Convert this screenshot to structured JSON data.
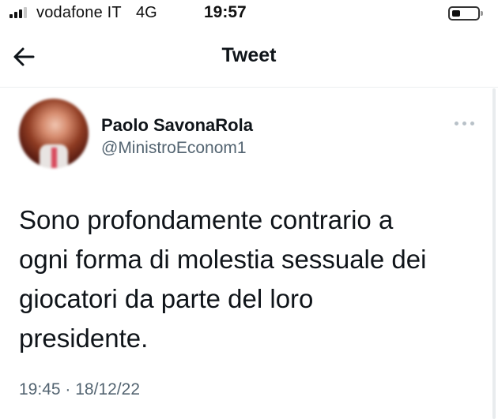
{
  "status_bar": {
    "carrier": "vodafone IT",
    "network": "4G",
    "time": "19:57"
  },
  "header": {
    "title": "Tweet"
  },
  "tweet": {
    "author_name": "Paolo SavonaRola",
    "author_handle": "@MinistroEconom1",
    "text_lines": [
      "Sono profondamente contrario a",
      "ogni forma di molestia sessuale dei",
      "giocatori da parte del loro",
      "presidente."
    ],
    "time": "19:45",
    "separator": "·",
    "date": "18/12/22"
  },
  "icons": {
    "back": "arrow-left-icon",
    "more": "more-horizontal-icon",
    "signal": "signal-icon",
    "battery": "battery-icon"
  },
  "colors": {
    "text_primary": "#0f1419",
    "text_secondary": "#536471",
    "background": "#ffffff"
  }
}
